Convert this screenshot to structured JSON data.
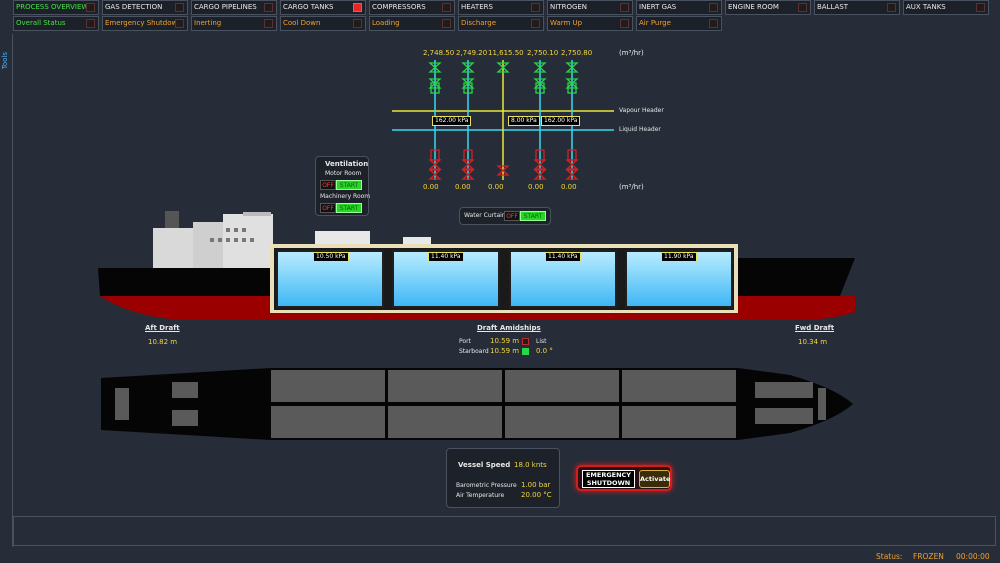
{
  "nav": {
    "row1": [
      {
        "label": "PROCESS OVERVIEW",
        "style": "active",
        "indicator": "off"
      },
      {
        "label": "GAS DETECTION",
        "style": "",
        "indicator": "off"
      },
      {
        "label": "CARGO PIPELINES",
        "style": "",
        "indicator": "off"
      },
      {
        "label": "CARGO TANKS",
        "style": "",
        "indicator": "alarm"
      },
      {
        "label": "COMPRESSORS",
        "style": "",
        "indicator": "off"
      },
      {
        "label": "HEATERS",
        "style": "",
        "indicator": "off"
      },
      {
        "label": "NITROGEN",
        "style": "",
        "indicator": "off"
      },
      {
        "label": "INERT GAS",
        "style": "",
        "indicator": "off"
      },
      {
        "label": "ENGINE ROOM",
        "style": "",
        "indicator": "off"
      },
      {
        "label": "BALLAST",
        "style": "",
        "indicator": "off"
      },
      {
        "label": "AUX TANKS",
        "style": "",
        "indicator": "off"
      }
    ],
    "row2": [
      {
        "label": "Overall Status",
        "style": "green",
        "indicator": "off"
      },
      {
        "label": "Emergency Shutdown",
        "style": "orange",
        "indicator": "off"
      },
      {
        "label": "Inerting",
        "style": "orange",
        "indicator": "off"
      },
      {
        "label": "Cool Down",
        "style": "orange",
        "indicator": "off"
      },
      {
        "label": "Loading",
        "style": "orange",
        "indicator": "off"
      },
      {
        "label": "Discharge",
        "style": "orange",
        "indicator": "off"
      },
      {
        "label": "Warm Up",
        "style": "orange",
        "indicator": "off"
      },
      {
        "label": "Air Purge",
        "style": "orange",
        "indicator": "off"
      }
    ]
  },
  "tools_label": "Tools",
  "manifold": {
    "top_flows": [
      "2,748.50",
      "2,749.20",
      "11,615.50",
      "2,750.10",
      "2,750.80"
    ],
    "top_unit": "(m³/hr)",
    "bottom_flows": [
      "0.00",
      "0.00",
      "0.00",
      "0.00",
      "0.00"
    ],
    "bottom_unit": "(m³/hr)",
    "vapour_header": "Vapour Header",
    "liquid_header": "Liquid Header",
    "pressures": [
      "162.00 kPa",
      "8.00 kPa",
      "162.00 kPa"
    ]
  },
  "ventilation": {
    "title": "Ventilation",
    "motor_room": "Motor Room",
    "machinery_room": "Machinery Room",
    "off": "OFF",
    "start": "START"
  },
  "water_curtain": {
    "label": "Water Curtain",
    "off": "OFF",
    "start": "START"
  },
  "tanks": {
    "pressures": [
      "10.50 kPa",
      "11.40 kPa",
      "11.40 kPa",
      "11.90 kPa"
    ]
  },
  "drafts": {
    "aft_label": "Aft Draft",
    "aft_value": "10.82 m",
    "mid_label": "Draft Amidships",
    "port_label": "Port",
    "port_value": "10.59 m",
    "starboard_label": "Starboard",
    "starboard_value": "10.59 m",
    "list_label": "List",
    "list_value": "0.0 °",
    "fwd_label": "Fwd Draft",
    "fwd_value": "10.34 m"
  },
  "info": {
    "speed_label": "Vessel Speed",
    "speed_value": "18.0 knts",
    "baro_label": "Barometric Pressure",
    "baro_value": "1.00 bar",
    "air_label": "Air Temperature",
    "air_value": "20.00 °C"
  },
  "esd": {
    "button": "EMERGENCY SHUTDOWN",
    "activate": "Activate"
  },
  "status": {
    "label": "Status:",
    "value": "FROZEN",
    "time": "00:00:00"
  },
  "colors": {
    "vapour": "#e8e83a",
    "liquid": "#3ad8f0",
    "valve_green": "#28d64a",
    "valve_red": "#d42020",
    "hull_red": "#9b0000"
  }
}
